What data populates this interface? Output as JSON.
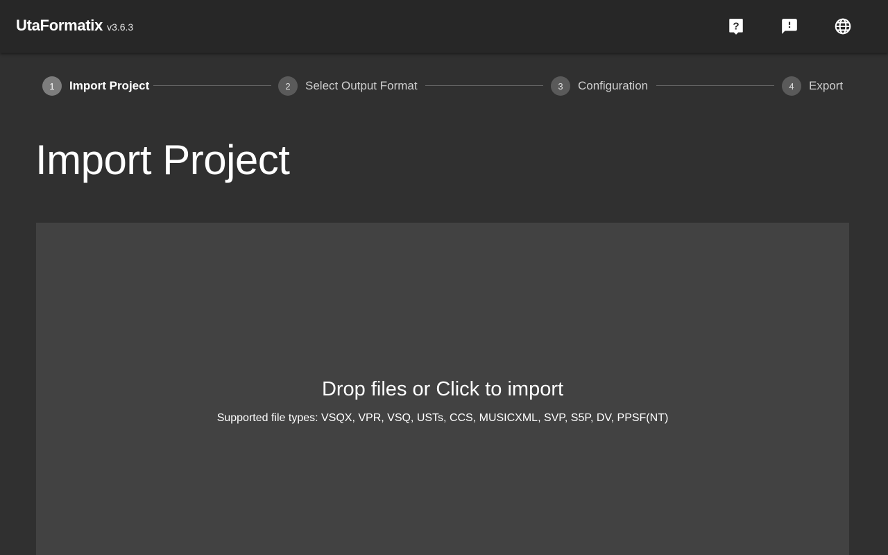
{
  "appbar": {
    "title": "UtaFormatix",
    "version": "v3.6.3",
    "actions": [
      {
        "icon": "help-icon"
      },
      {
        "icon": "feedback-icon"
      },
      {
        "icon": "language-icon"
      }
    ]
  },
  "stepper": {
    "steps": [
      {
        "number": "1",
        "label": "Import Project",
        "active": true
      },
      {
        "number": "2",
        "label": "Select Output Format",
        "active": false
      },
      {
        "number": "3",
        "label": "Configuration",
        "active": false
      },
      {
        "number": "4",
        "label": "Export",
        "active": false
      }
    ]
  },
  "main": {
    "title": "Import Project",
    "dropzone": {
      "headline": "Drop files or Click to import",
      "supported": "Supported file types: VSQX, VPR, VSQ, USTs, CCS, MUSICXML, SVP, S5P, DV, PPSF(NT)"
    }
  },
  "colors": {
    "background": "#303030",
    "appbar": "#272727",
    "dropzone": "#424242",
    "step_active": "#7d7d7d",
    "step_inactive": "#5a5a5a"
  }
}
